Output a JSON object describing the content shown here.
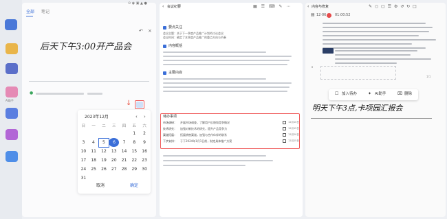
{
  "panel1": {
    "tab_active": "全部",
    "tab_2": "笔记",
    "handwriting": "后天下午3:00开产品会",
    "date_title": "2023年12月",
    "weekdays": [
      "日",
      "一",
      "二",
      "三",
      "四",
      "五",
      "六"
    ],
    "weeks": [
      [
        "",
        "",
        "",
        "",
        "",
        "1",
        "2"
      ],
      [
        "3",
        "4",
        "5",
        "6",
        "7",
        "8",
        "9"
      ],
      [
        "10",
        "11",
        "12",
        "13",
        "14",
        "15",
        "16"
      ],
      [
        "17",
        "18",
        "19",
        "20",
        "21",
        "22",
        "23"
      ],
      [
        "24",
        "25",
        "26",
        "27",
        "28",
        "29",
        "30"
      ],
      [
        "31",
        "",
        "",
        "",
        "",
        "",
        ""
      ]
    ],
    "selected_day": "6",
    "cancel_label": "取消",
    "confirm_label": "确定",
    "sidebar_labels": [
      "",
      "",
      "",
      "AI助手",
      "",
      ""
    ],
    "status_icons": "⊙ ◉ ▣ ▲ ●"
  },
  "panel2": {
    "header_title": "会议纪要",
    "toolbar_icons": "▦ ☰ ⌨ ✎ ⋯",
    "sections": [
      {
        "title": "要点关注",
        "lines": [
          "会议主题：关于下一季度产品推广计划的讨论会议",
          "会议时间：确定了本季度产品推广的重点方向与节奏"
        ]
      },
      {
        "title": "内容概括",
        "lines": [
          "",
          "",
          "",
          ""
        ]
      },
      {
        "title": "主要内容",
        "lines": [
          "",
          "",
          "",
          ""
        ]
      }
    ],
    "todo_title": "待办事项",
    "todo_items": [
      {
        "label": "市场调研：",
        "text": "开展市场调查，了解用户反馈和竞争情况",
        "date": "12月10日"
      },
      {
        "label": "技术研究：",
        "text": "加强对新技术的研究，提升产品竞争力",
        "date": "12月15日"
      },
      {
        "label": "渠道拓展：",
        "text": "拓展销售渠道，加强与合作伙伴的联系",
        "date": "12月20日"
      },
      {
        "label": "下步安排：",
        "text": "于下2024年1月1日前，制定具体推广方案",
        "date": "12月25日"
      }
    ]
  },
  "panel3": {
    "header_title": "内容与修复",
    "date_short": "12·06",
    "time": "01:00:52",
    "toolbar_icons": "✎ ○ ▢ ☰ ⚙ ↺ ↻ □",
    "popup_buttons": [
      "加入待办",
      "AI助手",
      "删除"
    ],
    "popup_icons": [
      "☐",
      "✦",
      "⌧"
    ],
    "handwriting": "明天下午3点,卡项园汇报会",
    "small_label": "1/1"
  }
}
